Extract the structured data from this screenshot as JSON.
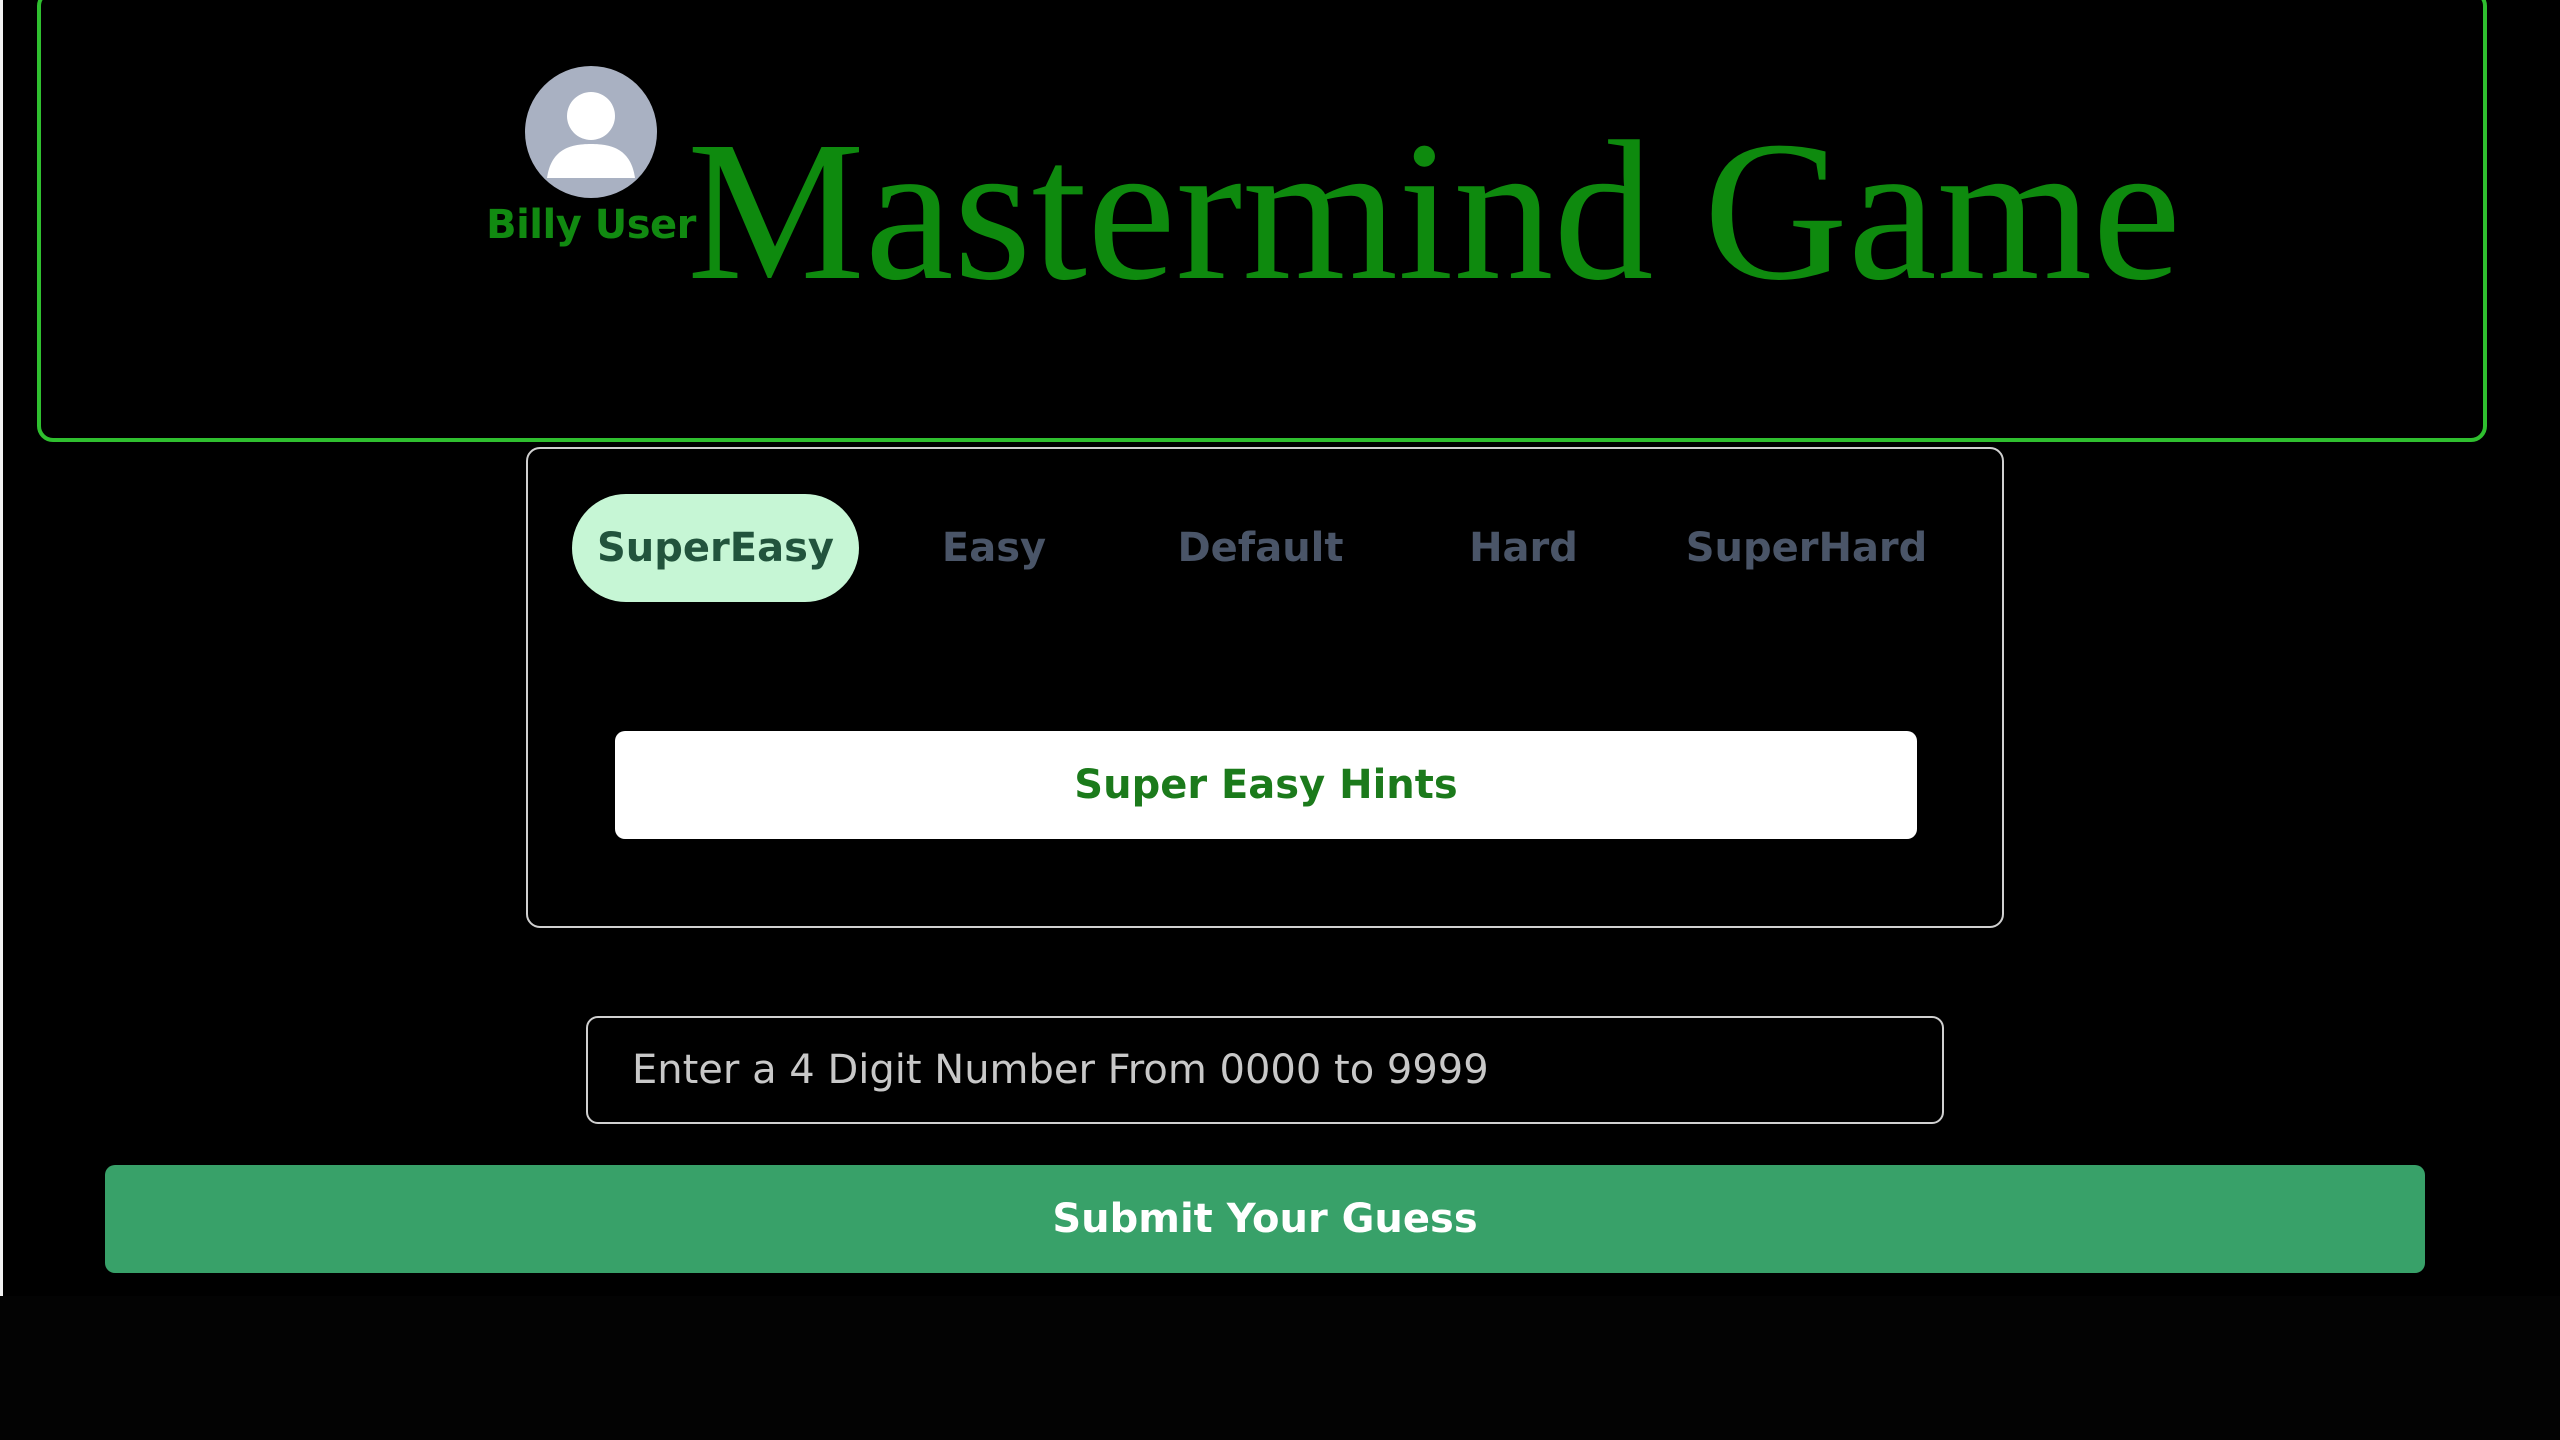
{
  "header": {
    "title": "Mastermind Game",
    "user": {
      "name": "Billy User",
      "avatar_icon": "user-avatar-icon"
    }
  },
  "difficulty": {
    "tabs": [
      {
        "label": "SuperEasy",
        "active": true
      },
      {
        "label": "Easy",
        "active": false
      },
      {
        "label": "Default",
        "active": false
      },
      {
        "label": "Hard",
        "active": false
      },
      {
        "label": "SuperHard",
        "active": false
      }
    ],
    "hints_button_label": "Super Easy Hints"
  },
  "guess": {
    "placeholder": "Enter a 4 Digit Number From 0000 to 9999",
    "value": ""
  },
  "submit_label": "Submit Your Guess",
  "colors": {
    "background": "#000000",
    "accent_green": "#0e8a0e",
    "header_border": "#2fbf2f",
    "active_tab_bg": "#c6f6d5",
    "submit_bg": "#38a169"
  }
}
